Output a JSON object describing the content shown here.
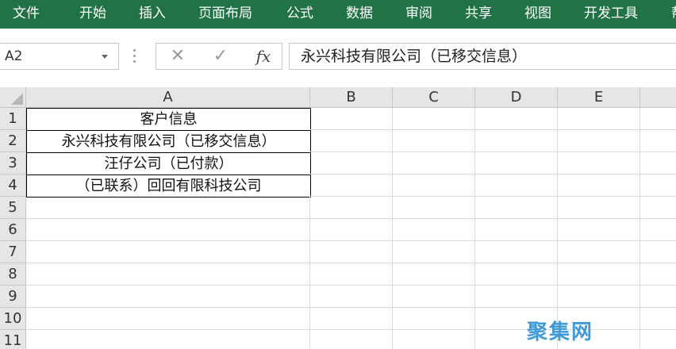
{
  "ribbon": {
    "tabs": [
      "文件",
      "开始",
      "插入",
      "页面布局",
      "公式",
      "数据",
      "审阅",
      "共享",
      "视图",
      "开发工具",
      "帮"
    ]
  },
  "formula_bar": {
    "name_box": "A2",
    "cancel_icon": "close-icon",
    "enter_icon": "check-icon",
    "fx_label": "fx",
    "formula_value": "永兴科技有限公司（已移交信息）"
  },
  "grid": {
    "columns": [
      "A",
      "B",
      "C",
      "D",
      "E"
    ],
    "rows": [
      "1",
      "2",
      "3",
      "4",
      "5",
      "6",
      "7",
      "8",
      "9",
      "10",
      "11"
    ],
    "cells": {
      "A1": "客户信息",
      "A2": "永兴科技有限公司（已移交信息）",
      "A3": "汪仔公司（已付款）",
      "A4": "（已联系）回回有限科技公司"
    }
  },
  "watermark": "聚集网",
  "colors": {
    "ribbon": "#217346",
    "header_bg": "#e6e6e6"
  }
}
